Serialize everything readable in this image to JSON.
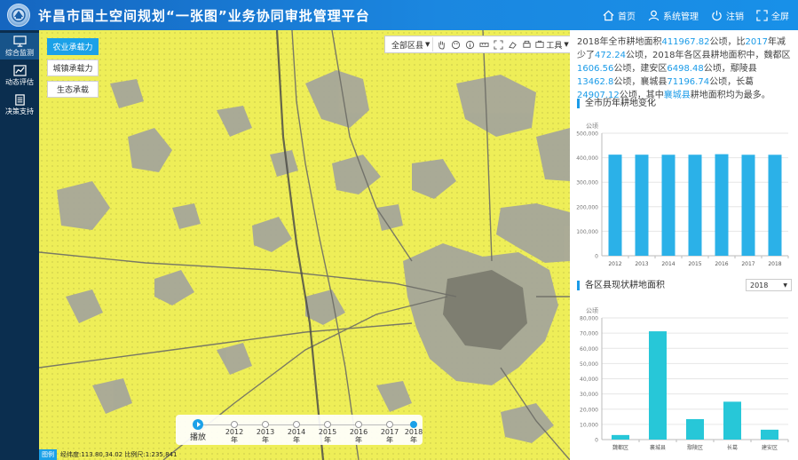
{
  "header": {
    "title": "许昌市国土空间规划“一张图”业务协同审批管理平台",
    "nav": [
      {
        "label": "首页",
        "icon": "home-icon"
      },
      {
        "label": "系统管理",
        "icon": "user-icon"
      },
      {
        "label": "注销",
        "icon": "power-icon"
      },
      {
        "label": "全屏",
        "icon": "expand-icon"
      }
    ]
  },
  "sidebar": {
    "items": [
      {
        "label": "综合监测",
        "icon": "monitor-icon"
      },
      {
        "label": "动态评估",
        "icon": "chart-line-icon"
      },
      {
        "label": "决策支持",
        "icon": "document-icon"
      }
    ]
  },
  "map": {
    "layer_buttons": [
      "农业承载力",
      "城镇承载力",
      "生态承载"
    ],
    "toolbar": {
      "region": "全部区县",
      "tools_label": "工具"
    },
    "timeline": {
      "play_label": "播放",
      "years": [
        "2012年",
        "2013年",
        "2014年",
        "2015年",
        "2016年",
        "2017年",
        "2018年"
      ],
      "active_index": 6
    },
    "status": {
      "tag": "图例",
      "coords": "经纬度:113.80,34.02 比例尺:1:235,841"
    }
  },
  "summary": {
    "p1": "2018年全市耕地面积",
    "v1": "411967.82",
    "p2": "公顷，比",
    "v2": "2017",
    "p3": "年减少了",
    "v3": "472.24",
    "p4": "公顷，2018年各区县耕地面积中，魏都区",
    "v4": "1606.56",
    "p5": "公顷，建安区",
    "v5": "6498.48",
    "p6": "公顷，鄢陵县",
    "v6": "13462.8",
    "p7": "公顷，襄城县",
    "v7": "71196.74",
    "p8": "公顷，长葛",
    "v8": "24907.12",
    "p9": "公顷，其中",
    "v9": "襄城县",
    "p10": "耕地面积均为最多。"
  },
  "charts": {
    "trend": {
      "title": "全市历年耕地变化",
      "unit": "公顷"
    },
    "county": {
      "title": "各区县现状耕地面积",
      "unit": "公顷",
      "year": "2018"
    }
  },
  "chart_data": [
    {
      "type": "bar",
      "title": "全市历年耕地变化",
      "ylabel": "公顷",
      "categories": [
        "2012",
        "2013",
        "2014",
        "2015",
        "2016",
        "2017",
        "2018"
      ],
      "values": [
        412500,
        412300,
        412100,
        412200,
        414400,
        412000,
        411968
      ],
      "ylim": [
        0,
        500000
      ],
      "yticks": [
        0,
        100000,
        200000,
        300000,
        400000,
        500000
      ],
      "ytick_labels": [
        "0",
        "100,000",
        "200,000",
        "300,000",
        "400,000",
        "500,000"
      ],
      "color": "#2bb1e8"
    },
    {
      "type": "bar",
      "title": "各区县现状耕地面积",
      "ylabel": "公顷",
      "categories": [
        "魏都区",
        "襄城县",
        "鄢陵区",
        "长葛",
        "建安区"
      ],
      "values": [
        3000,
        71197,
        13463,
        24907,
        6498
      ],
      "ylim": [
        0,
        80000
      ],
      "yticks": [
        0,
        10000,
        20000,
        30000,
        40000,
        50000,
        60000,
        70000,
        80000
      ],
      "ytick_labels": [
        "0",
        "10,000",
        "20,000",
        "30,000",
        "40,000",
        "50,000",
        "60,000",
        "70,000",
        "80,000"
      ],
      "color": "#27c7d8"
    }
  ]
}
